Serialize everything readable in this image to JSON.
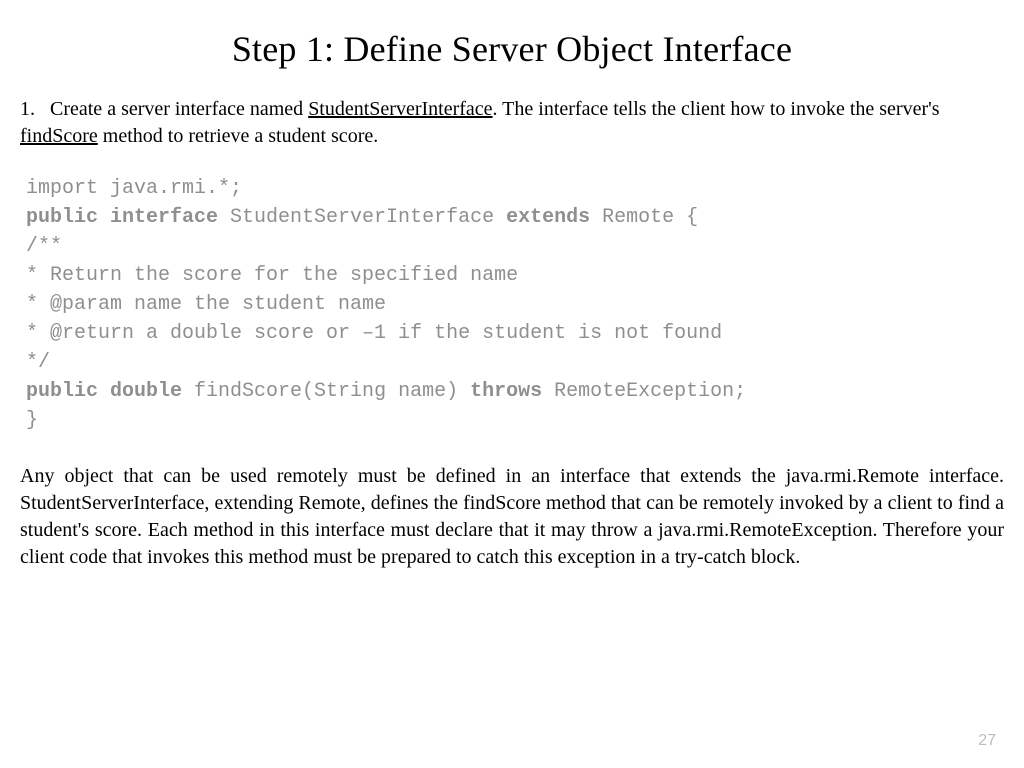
{
  "title": "Step 1: Define Server Object Interface",
  "intro": {
    "num": "1.",
    "part1": "Create a server interface named ",
    "iface": "StudentServerInterface",
    "part2": ". The interface tells the client how to invoke the server's ",
    "method": "findScore",
    "part3": " method to retrieve a student score."
  },
  "code": {
    "l1": "import java.rmi.*;",
    "l2a": "public interface",
    "l2b": " StudentServerInterface ",
    "l2c": "extends",
    "l2d": " Remote {",
    "l3": "/**",
    "l4": "* Return the score for the specified name",
    "l5": "* @param name the student name",
    "l6": "* @return a double score or –1 if the student is not found",
    "l7": "*/",
    "l8a": "public double",
    "l8b": " findScore(String name) ",
    "l8c": "throws",
    "l8d": " RemoteException;",
    "l9": "}"
  },
  "explain": "Any object that can be used remotely must be defined in an interface that extends the java.rmi.Remote interface. StudentServerInterface, extending Remote, defines the findScore method that can be remotely invoked by a client to find a student's score. Each method in this interface must declare that it may throw a java.rmi.RemoteException. Therefore your client code that invokes this method must be prepared to catch this exception in a try-catch block.",
  "pagenum": "27"
}
